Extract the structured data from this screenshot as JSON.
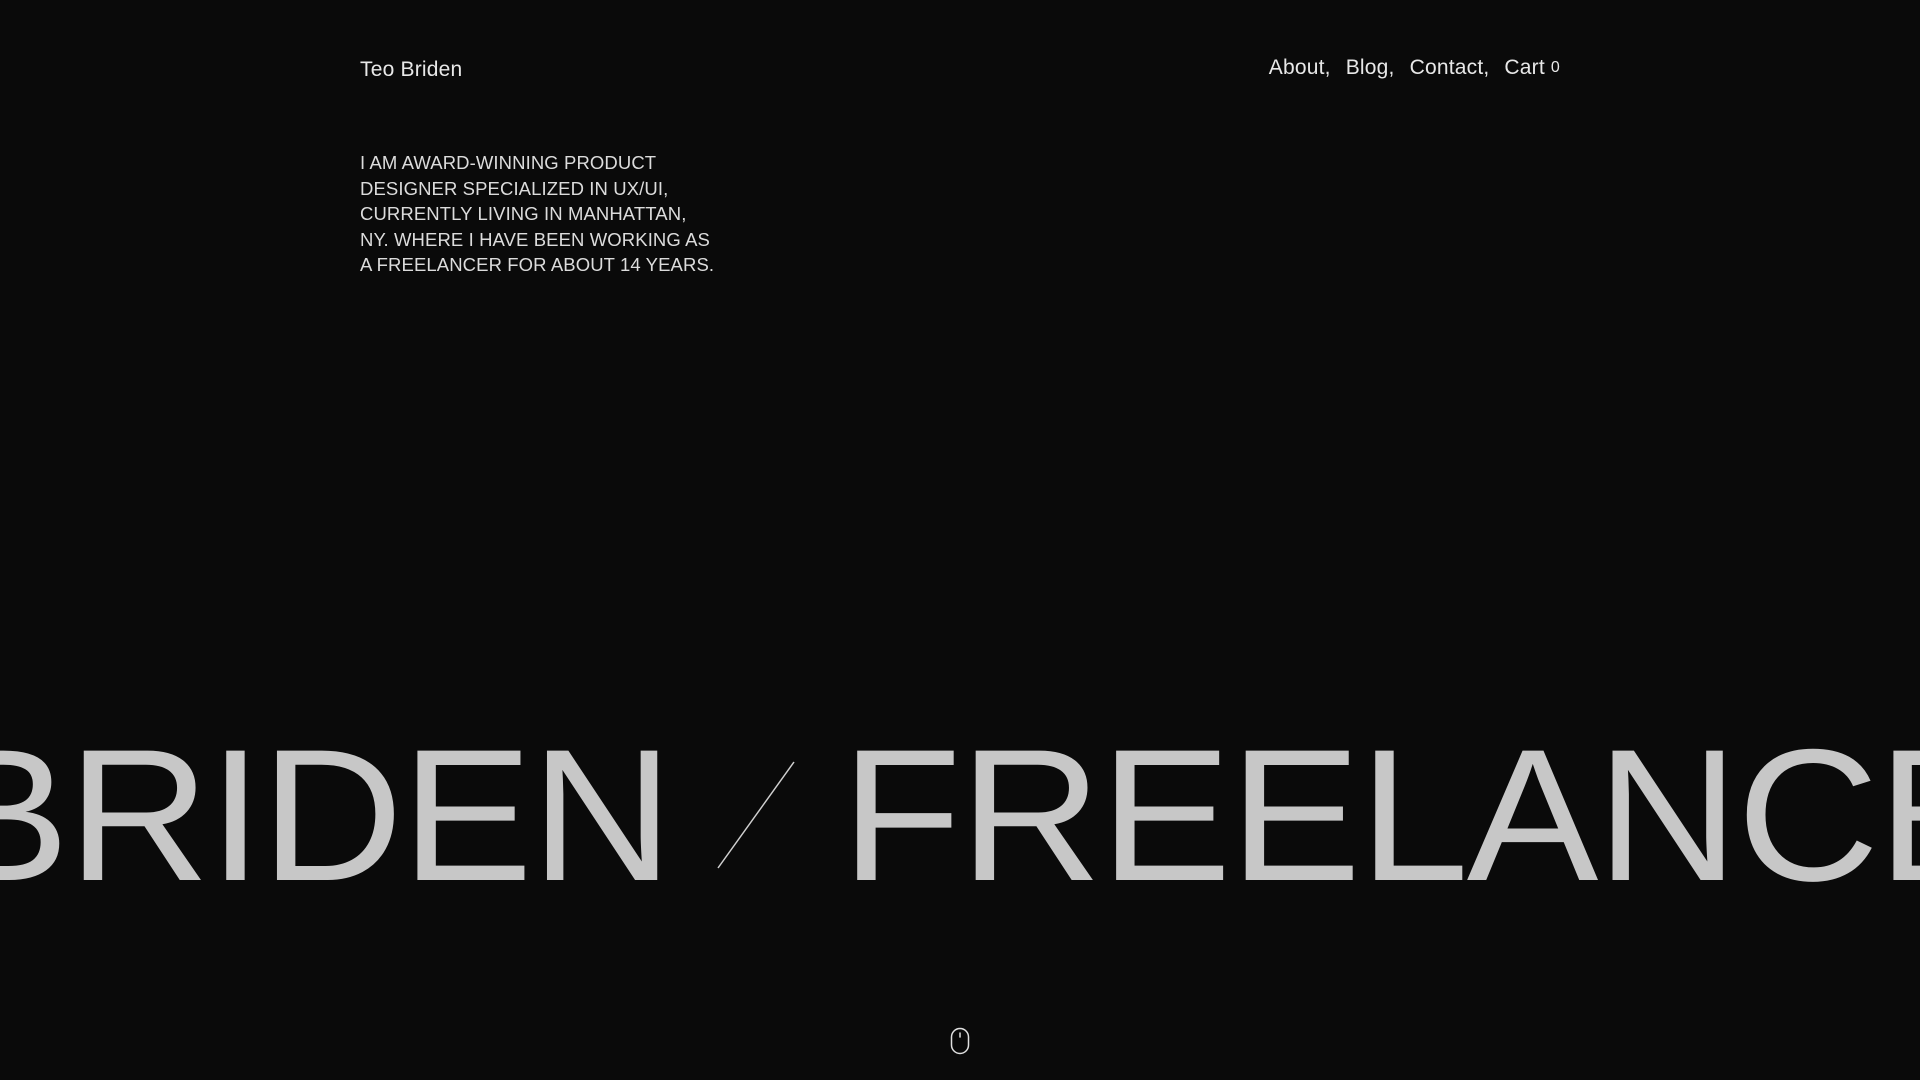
{
  "header": {
    "brand": "Teo Briden",
    "nav": [
      {
        "label": "About,"
      },
      {
        "label": "Blog,"
      },
      {
        "label": "Contact,"
      },
      {
        "label": "Cart"
      }
    ],
    "cart_count": "0"
  },
  "bio": {
    "lines": [
      "I AM AWARD-WINNING PRODUCT",
      "DESIGNER SPECIALIZED IN UX/UI,",
      "CURRENTLY LIVING IN MANHATTAN,",
      "NY. WHERE I HAVE BEEN WORKING AS",
      "A FREELANCER FOR ABOUT 14 YEARS."
    ]
  },
  "marquee": {
    "words": [
      "BRIDEN",
      "FREELANCER"
    ]
  },
  "icons": {
    "divider": "slash-divider-icon",
    "scroll": "mouse-scroll-icon"
  },
  "colors": {
    "background": "#0a0a0a",
    "text": "#e8e8e8",
    "headline": "#c7c7c7"
  }
}
